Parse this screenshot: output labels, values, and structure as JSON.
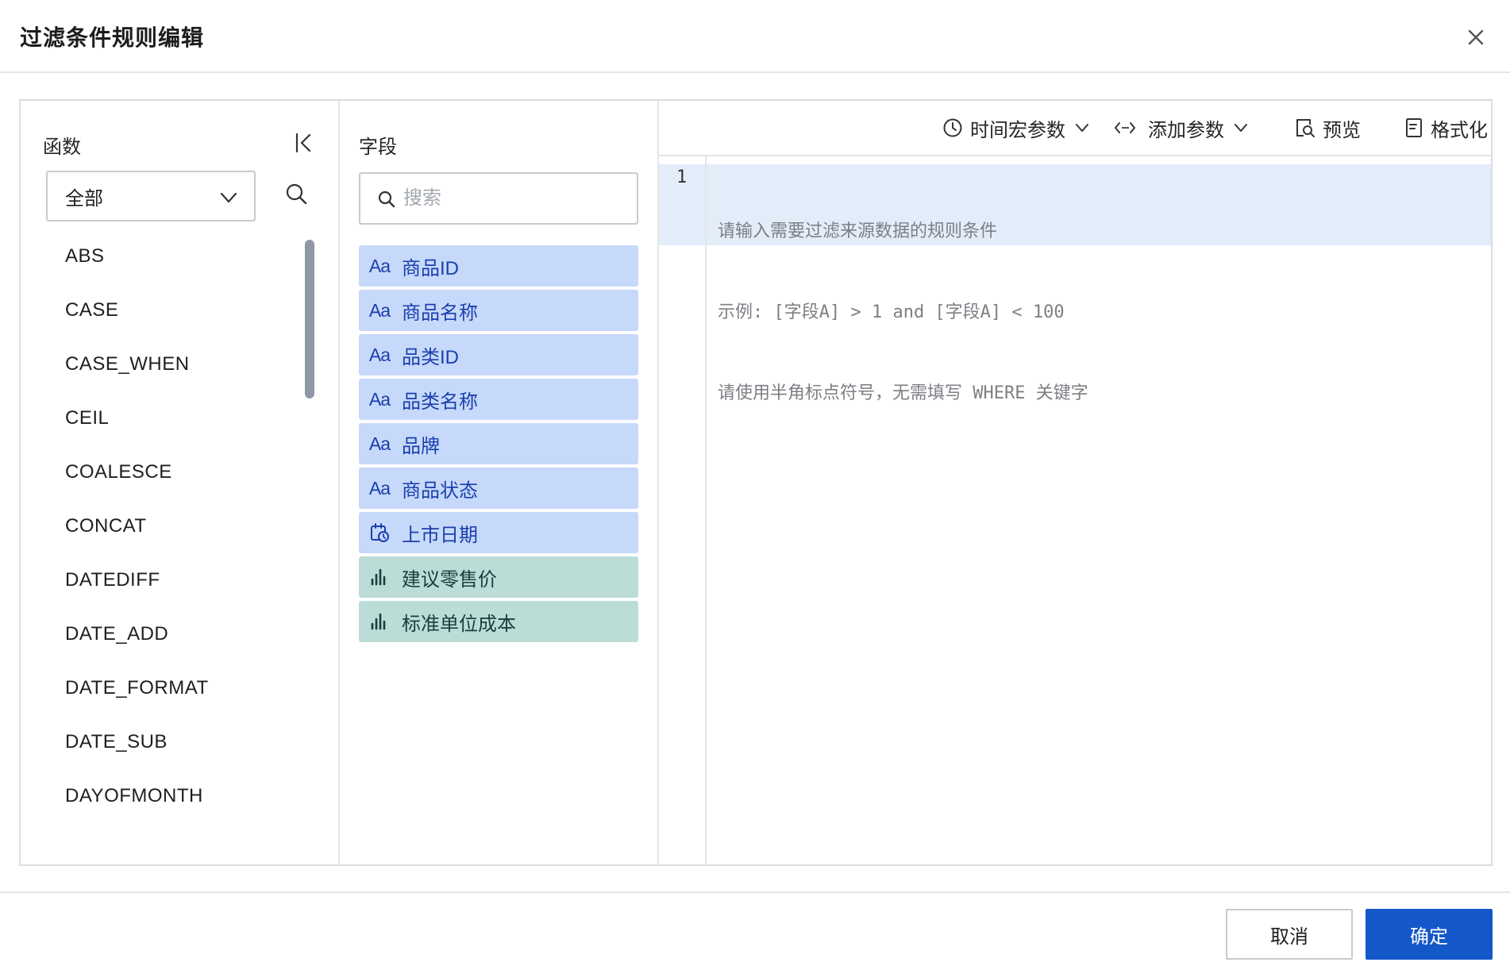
{
  "dialog": {
    "title": "过滤条件规则编辑",
    "close_icon": "close-icon"
  },
  "functions": {
    "label": "函数",
    "category_selected": "全部",
    "items": [
      "ABS",
      "CASE",
      "CASE_WHEN",
      "CEIL",
      "COALESCE",
      "CONCAT",
      "DATEDIFF",
      "DATE_ADD",
      "DATE_FORMAT",
      "DATE_SUB",
      "DAYOFMONTH"
    ]
  },
  "fields": {
    "label": "字段",
    "search_placeholder": "搜索",
    "items": [
      {
        "name": "商品ID",
        "type": "text",
        "icon": "Aa"
      },
      {
        "name": "商品名称",
        "type": "text",
        "icon": "Aa"
      },
      {
        "name": "品类ID",
        "type": "text",
        "icon": "Aa"
      },
      {
        "name": "品类名称",
        "type": "text",
        "icon": "Aa"
      },
      {
        "name": "品牌",
        "type": "text",
        "icon": "Aa"
      },
      {
        "name": "商品状态",
        "type": "text",
        "icon": "Aa"
      },
      {
        "name": "上市日期",
        "type": "date",
        "icon": "calendar-clock-icon"
      },
      {
        "name": "建议零售价",
        "type": "measure",
        "icon": "bar-chart-icon"
      },
      {
        "name": "标准单位成本",
        "type": "measure",
        "icon": "bar-chart-icon"
      }
    ]
  },
  "toolbar": {
    "time_macro_label": "时间宏参数",
    "add_param_label": "添加参数",
    "preview_label": "预览",
    "format_label": "格式化"
  },
  "editor": {
    "line_number": "1",
    "placeholder_lines": [
      "请输入需要过滤来源数据的规则条件",
      "示例: [字段A] > 1 and [字段A] < 100",
      "请使用半角标点符号，无需填写 WHERE 关键字"
    ]
  },
  "footer": {
    "cancel_label": "取消",
    "ok_label": "确定"
  },
  "colors": {
    "primary": "#1457c9",
    "dimension_bg": "#c7d9fa",
    "dimension_text": "#1a3fae",
    "measure_bg": "#bcdcd8",
    "measure_text": "#1a3e3c",
    "editor_highlight": "#e3ecf9"
  }
}
